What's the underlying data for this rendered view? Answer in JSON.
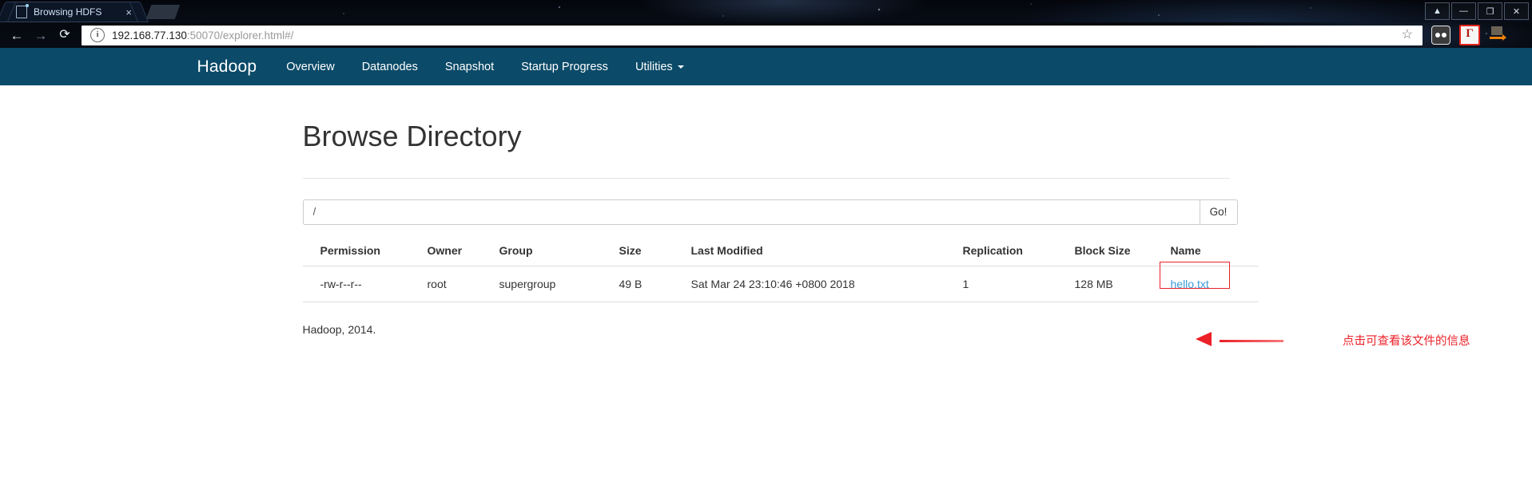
{
  "browser": {
    "tab": {
      "title": "Browsing HDFS",
      "favicon": "page-icon",
      "close": "×"
    },
    "nav": {
      "back": "←",
      "forward": "→",
      "reload": "⟳"
    },
    "omnibox": {
      "info_icon": "i",
      "url_host": "192.168.77.130",
      "url_rest": ":50070/explorer.html#/",
      "star": "☆"
    },
    "window_controls": {
      "profile": "▲",
      "minimize": "—",
      "maximize": "❐",
      "close": "✕"
    },
    "extensions": [
      {
        "name": "glasses-extension-icon"
      },
      {
        "name": "pdf-extension-icon",
        "glyph": "Г"
      },
      {
        "name": "download-extension-icon"
      }
    ]
  },
  "navbar": {
    "brand": "Hadoop",
    "links": [
      {
        "label": "Overview",
        "name": "nav-link-overview",
        "dropdown": false
      },
      {
        "label": "Datanodes",
        "name": "nav-link-datanodes",
        "dropdown": false
      },
      {
        "label": "Snapshot",
        "name": "nav-link-snapshot",
        "dropdown": false
      },
      {
        "label": "Startup Progress",
        "name": "nav-link-startup-progress",
        "dropdown": false
      },
      {
        "label": "Utilities",
        "name": "nav-link-utilities",
        "dropdown": true
      }
    ]
  },
  "main": {
    "title": "Browse Directory",
    "path_input": {
      "value": "/",
      "placeholder": "/"
    },
    "go_button": "Go!",
    "table": {
      "headers": [
        "Permission",
        "Owner",
        "Group",
        "Size",
        "Last Modified",
        "Replication",
        "Block Size",
        "Name"
      ],
      "rows": [
        {
          "permission": "-rw-r--r--",
          "owner": "root",
          "group": "supergroup",
          "size": "49 B",
          "last_modified": "Sat Mar 24 23:10:46 +0800 2018",
          "replication": "1",
          "block_size": "128 MB",
          "name": "hello.txt"
        }
      ]
    },
    "footer": "Hadoop, 2014."
  },
  "annotation": {
    "text": "点击可查看该文件的信息",
    "color": "#ec2027"
  },
  "colors": {
    "navbar_bg": "#0b4a68",
    "link_blue": "#3b9cd9",
    "annotation_red": "#ec2027",
    "chrome_dark": "#05080f"
  }
}
